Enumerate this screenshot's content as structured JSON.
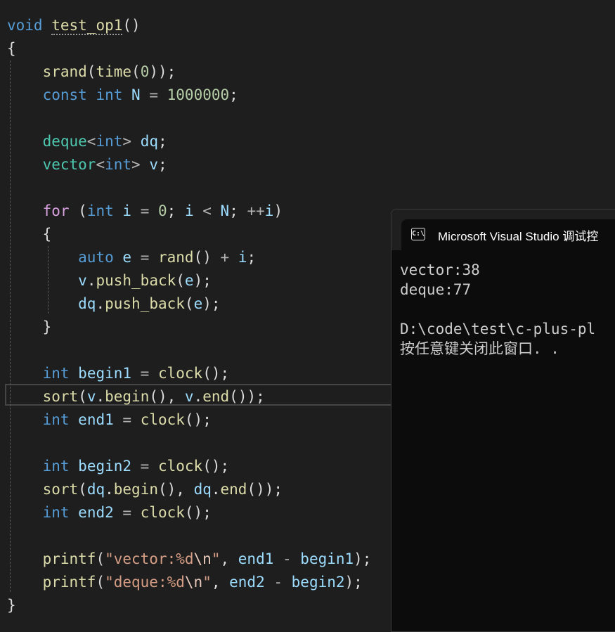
{
  "editor": {
    "lines": [
      [
        {
          "t": "void",
          "c": "kw"
        },
        {
          "t": " ",
          "c": "pl"
        },
        {
          "t": "test_op1",
          "c": "fn squiggle"
        },
        {
          "t": "()",
          "c": "pl"
        }
      ],
      [
        {
          "t": "{",
          "c": "pl"
        }
      ],
      [
        {
          "t": "    ",
          "c": "pl"
        },
        {
          "t": "srand",
          "c": "fn"
        },
        {
          "t": "(",
          "c": "pl"
        },
        {
          "t": "time",
          "c": "fn"
        },
        {
          "t": "(",
          "c": "pl"
        },
        {
          "t": "0",
          "c": "num"
        },
        {
          "t": "));",
          "c": "pl"
        }
      ],
      [
        {
          "t": "    ",
          "c": "pl"
        },
        {
          "t": "const",
          "c": "kw"
        },
        {
          "t": " ",
          "c": "pl"
        },
        {
          "t": "int",
          "c": "kw"
        },
        {
          "t": " ",
          "c": "pl"
        },
        {
          "t": "N",
          "c": "var"
        },
        {
          "t": " = ",
          "c": "op"
        },
        {
          "t": "1000000",
          "c": "num"
        },
        {
          "t": ";",
          "c": "pl"
        }
      ],
      [],
      [
        {
          "t": "    ",
          "c": "pl"
        },
        {
          "t": "deque",
          "c": "type"
        },
        {
          "t": "<",
          "c": "op"
        },
        {
          "t": "int",
          "c": "kw"
        },
        {
          "t": ">",
          "c": "op"
        },
        {
          "t": " ",
          "c": "pl"
        },
        {
          "t": "dq",
          "c": "var"
        },
        {
          "t": ";",
          "c": "pl"
        }
      ],
      [
        {
          "t": "    ",
          "c": "pl"
        },
        {
          "t": "vector",
          "c": "type"
        },
        {
          "t": "<",
          "c": "op"
        },
        {
          "t": "int",
          "c": "kw"
        },
        {
          "t": ">",
          "c": "op"
        },
        {
          "t": " ",
          "c": "pl"
        },
        {
          "t": "v",
          "c": "var"
        },
        {
          "t": ";",
          "c": "pl"
        }
      ],
      [],
      [
        {
          "t": "    ",
          "c": "pl"
        },
        {
          "t": "for",
          "c": "ctl"
        },
        {
          "t": " (",
          "c": "pl"
        },
        {
          "t": "int",
          "c": "kw"
        },
        {
          "t": " ",
          "c": "pl"
        },
        {
          "t": "i",
          "c": "var"
        },
        {
          "t": " = ",
          "c": "op"
        },
        {
          "t": "0",
          "c": "num"
        },
        {
          "t": "; ",
          "c": "pl"
        },
        {
          "t": "i",
          "c": "var"
        },
        {
          "t": " < ",
          "c": "op"
        },
        {
          "t": "N",
          "c": "var"
        },
        {
          "t": "; ",
          "c": "pl"
        },
        {
          "t": "++",
          "c": "op"
        },
        {
          "t": "i",
          "c": "var"
        },
        {
          "t": ")",
          "c": "pl"
        }
      ],
      [
        {
          "t": "    {",
          "c": "pl"
        }
      ],
      [
        {
          "t": "        ",
          "c": "pl"
        },
        {
          "t": "auto",
          "c": "kw"
        },
        {
          "t": " ",
          "c": "pl"
        },
        {
          "t": "e",
          "c": "var"
        },
        {
          "t": " = ",
          "c": "op"
        },
        {
          "t": "rand",
          "c": "fn"
        },
        {
          "t": "() ",
          "c": "pl"
        },
        {
          "t": "+",
          "c": "op"
        },
        {
          "t": " ",
          "c": "pl"
        },
        {
          "t": "i",
          "c": "var"
        },
        {
          "t": ";",
          "c": "pl"
        }
      ],
      [
        {
          "t": "        ",
          "c": "pl"
        },
        {
          "t": "v",
          "c": "var"
        },
        {
          "t": ".",
          "c": "pl"
        },
        {
          "t": "push_back",
          "c": "fn"
        },
        {
          "t": "(",
          "c": "pl"
        },
        {
          "t": "e",
          "c": "var"
        },
        {
          "t": ");",
          "c": "pl"
        }
      ],
      [
        {
          "t": "        ",
          "c": "pl"
        },
        {
          "t": "dq",
          "c": "var"
        },
        {
          "t": ".",
          "c": "pl"
        },
        {
          "t": "push_back",
          "c": "fn"
        },
        {
          "t": "(",
          "c": "pl"
        },
        {
          "t": "e",
          "c": "var"
        },
        {
          "t": ");",
          "c": "pl"
        }
      ],
      [
        {
          "t": "    }",
          "c": "pl"
        }
      ],
      [],
      [
        {
          "t": "    ",
          "c": "pl"
        },
        {
          "t": "int",
          "c": "kw"
        },
        {
          "t": " ",
          "c": "pl"
        },
        {
          "t": "begin1",
          "c": "var"
        },
        {
          "t": " = ",
          "c": "op"
        },
        {
          "t": "clock",
          "c": "fn"
        },
        {
          "t": "();",
          "c": "pl"
        }
      ],
      [
        {
          "t": "    ",
          "c": "pl"
        },
        {
          "t": "sort",
          "c": "fn"
        },
        {
          "t": "(",
          "c": "pl"
        },
        {
          "t": "v",
          "c": "var"
        },
        {
          "t": ".",
          "c": "pl"
        },
        {
          "t": "begin",
          "c": "fn"
        },
        {
          "t": "(), ",
          "c": "pl"
        },
        {
          "t": "v",
          "c": "var"
        },
        {
          "t": ".",
          "c": "pl"
        },
        {
          "t": "end",
          "c": "fn"
        },
        {
          "t": "());",
          "c": "pl"
        }
      ],
      [
        {
          "t": "    ",
          "c": "pl"
        },
        {
          "t": "int",
          "c": "kw"
        },
        {
          "t": " ",
          "c": "pl"
        },
        {
          "t": "end1",
          "c": "var"
        },
        {
          "t": " = ",
          "c": "op"
        },
        {
          "t": "clock",
          "c": "fn"
        },
        {
          "t": "();",
          "c": "pl"
        }
      ],
      [],
      [
        {
          "t": "    ",
          "c": "pl"
        },
        {
          "t": "int",
          "c": "kw"
        },
        {
          "t": " ",
          "c": "pl"
        },
        {
          "t": "begin2",
          "c": "var"
        },
        {
          "t": " = ",
          "c": "op"
        },
        {
          "t": "clock",
          "c": "fn"
        },
        {
          "t": "();",
          "c": "pl"
        }
      ],
      [
        {
          "t": "    ",
          "c": "pl"
        },
        {
          "t": "sort",
          "c": "fn"
        },
        {
          "t": "(",
          "c": "pl"
        },
        {
          "t": "dq",
          "c": "var"
        },
        {
          "t": ".",
          "c": "pl"
        },
        {
          "t": "begin",
          "c": "fn"
        },
        {
          "t": "(), ",
          "c": "pl"
        },
        {
          "t": "dq",
          "c": "var"
        },
        {
          "t": ".",
          "c": "pl"
        },
        {
          "t": "end",
          "c": "fn"
        },
        {
          "t": "());",
          "c": "pl"
        }
      ],
      [
        {
          "t": "    ",
          "c": "pl"
        },
        {
          "t": "int",
          "c": "kw"
        },
        {
          "t": " ",
          "c": "pl"
        },
        {
          "t": "end2",
          "c": "var"
        },
        {
          "t": " = ",
          "c": "op"
        },
        {
          "t": "clock",
          "c": "fn"
        },
        {
          "t": "();",
          "c": "pl"
        }
      ],
      [],
      [
        {
          "t": "    ",
          "c": "pl"
        },
        {
          "t": "printf",
          "c": "fn"
        },
        {
          "t": "(",
          "c": "pl"
        },
        {
          "t": "\"vector:%d",
          "c": "str"
        },
        {
          "t": "\\n",
          "c": "esc"
        },
        {
          "t": "\"",
          "c": "str"
        },
        {
          "t": ", ",
          "c": "pl"
        },
        {
          "t": "end1",
          "c": "var"
        },
        {
          "t": " - ",
          "c": "op"
        },
        {
          "t": "begin1",
          "c": "var"
        },
        {
          "t": ");",
          "c": "pl"
        }
      ],
      [
        {
          "t": "    ",
          "c": "pl"
        },
        {
          "t": "printf",
          "c": "fn"
        },
        {
          "t": "(",
          "c": "pl"
        },
        {
          "t": "\"deque:%d",
          "c": "str"
        },
        {
          "t": "\\n",
          "c": "esc"
        },
        {
          "t": "\"",
          "c": "str"
        },
        {
          "t": ", ",
          "c": "pl"
        },
        {
          "t": "end2",
          "c": "var"
        },
        {
          "t": " - ",
          "c": "op"
        },
        {
          "t": "begin2",
          "c": "var"
        },
        {
          "t": ");",
          "c": "pl"
        }
      ],
      [
        {
          "t": "}",
          "c": "pl"
        }
      ]
    ]
  },
  "console": {
    "title": "Microsoft Visual Studio 调试控",
    "icon_text": "C:\\",
    "lines": [
      "vector:38",
      "deque:77",
      "",
      "D:\\code\\test\\c-plus-pl",
      "按任意键关闭此窗口. ."
    ]
  },
  "colors": {
    "background": "#1e1e1e",
    "keyword": "#569cd6",
    "control": "#d8a0df",
    "type": "#4ec9b0",
    "function": "#dcdcaa",
    "variable": "#9cdcfe",
    "number": "#b5cea8",
    "string": "#d69d85",
    "console_background": "#0c0c0c"
  }
}
